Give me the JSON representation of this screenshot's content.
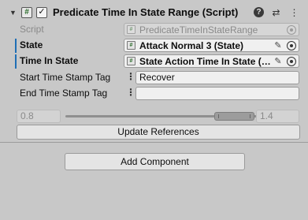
{
  "component": {
    "title": "Predicate Time In State Range (Script)",
    "enabled": true,
    "foldout_glyph": "▼",
    "script_icon_glyph": "#",
    "header_icons": [
      "help-icon",
      "presets-icon",
      "more-options-icon"
    ]
  },
  "fields": {
    "script": {
      "label": "Script",
      "value": "PredicateTimeInStateRange"
    },
    "state": {
      "label": "State",
      "value": "Attack Normal 3 (State)"
    },
    "time_in_state": {
      "label": "Time In State",
      "value": "State Action Time In State (…"
    },
    "start_tag": {
      "label": "Start Time Stamp Tag",
      "value": "Recover"
    },
    "end_tag": {
      "label": "End Time Stamp Tag",
      "value": ""
    }
  },
  "range_slider": {
    "min_value": "0.8",
    "max_value": "1.4",
    "state": "disabled"
  },
  "buttons": {
    "update_references": "Update References",
    "add_component": "Add Component"
  },
  "colors": {
    "override_bar": "#1f6fb5",
    "background": "#c8c8c8"
  }
}
